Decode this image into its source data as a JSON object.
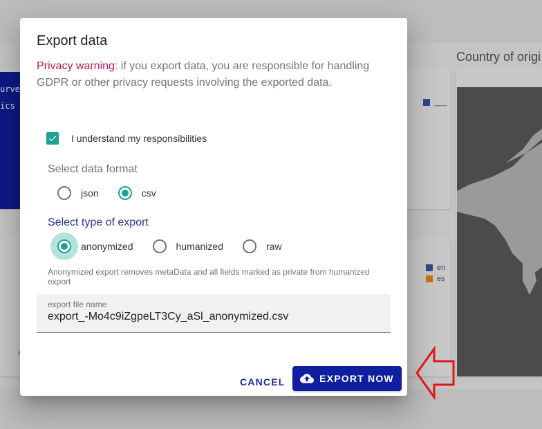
{
  "background": {
    "code_lines": [
      "urvey",
      "ics +"
    ],
    "panel_title": "Country of origi",
    "legend_top": [
      {
        "label": "___",
        "color": "#2e4a8a"
      }
    ],
    "legend_bottom": [
      {
        "label": "en",
        "color": "#2e4a8a"
      },
      {
        "label": "es",
        "color": "#c8730e"
      }
    ],
    "small_label": "N"
  },
  "dialog": {
    "title": "Export data",
    "warning_label": "Privacy warning",
    "warning_text": ": if you export data, you are responsible for handling GDPR or other privacy requests involving the exported data.",
    "checkbox": {
      "label": "I understand my responsibilities",
      "checked": true
    },
    "format": {
      "label": "Select data format",
      "options": [
        "json",
        "csv"
      ],
      "selected": "csv"
    },
    "export_type": {
      "label": "Select type of export",
      "options": [
        "anonymized",
        "humanized",
        "raw"
      ],
      "selected": "anonymized"
    },
    "hint": "Anonymized export removes metaData and all fields marked as private from humanized export",
    "file_name": {
      "label": "export file name",
      "value": "export_-Mo4c9iZgpeLT3Cy_aSl_anonymized.csv"
    },
    "buttons": {
      "cancel": "CANCEL",
      "export": "EXPORT NOW"
    }
  },
  "colors": {
    "accent": "#1ea193",
    "primary": "#0f1fa0",
    "warning": "#c2185b",
    "annotation": "#e0161c"
  },
  "icons": {
    "checkbox": "check-icon",
    "export": "cloud-upload-icon",
    "annotation": "left-arrow-icon"
  }
}
